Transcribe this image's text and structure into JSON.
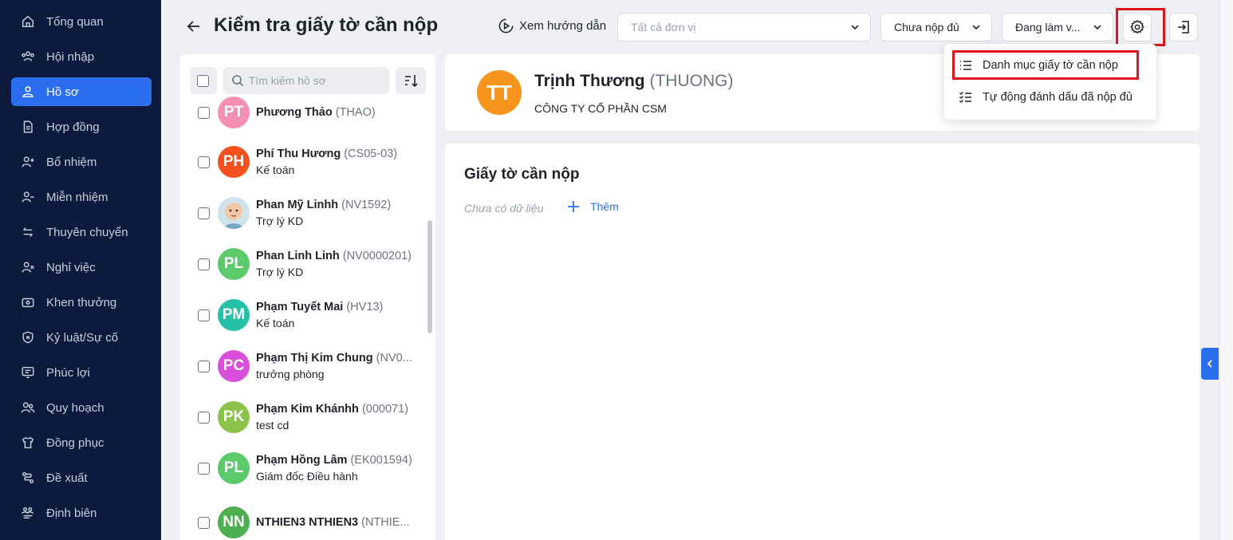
{
  "sidebar": {
    "items": [
      {
        "label": "Tổng quan",
        "icon": "home-icon"
      },
      {
        "label": "Hội nhập",
        "icon": "onboarding-icon"
      },
      {
        "label": "Hồ sơ",
        "icon": "user-icon",
        "active": true
      },
      {
        "label": "Hợp đồng",
        "icon": "document-icon"
      },
      {
        "label": "Bổ nhiệm",
        "icon": "user-add-icon"
      },
      {
        "label": "Miễn nhiệm",
        "icon": "user-remove-icon"
      },
      {
        "label": "Thuyên chuyển",
        "icon": "transfer-icon"
      },
      {
        "label": "Nghỉ việc",
        "icon": "user-leave-icon"
      },
      {
        "label": "Khen thưởng",
        "icon": "reward-icon"
      },
      {
        "label": "Kỷ luật/Sự cố",
        "icon": "shield-icon"
      },
      {
        "label": "Phúc lợi",
        "icon": "benefit-icon"
      },
      {
        "label": "Quy hoạch",
        "icon": "planning-icon"
      },
      {
        "label": "Đồng phục",
        "icon": "uniform-icon"
      },
      {
        "label": "Đề xuất",
        "icon": "proposal-icon"
      },
      {
        "label": "Định biên",
        "icon": "headcount-icon"
      }
    ]
  },
  "header": {
    "title": "Kiểm tra giấy tờ cần nộp",
    "guide_label": "Xem hướng dẫn",
    "unit_select": "Tất cả đơn vị",
    "status_select": "Chưa nộp đủ",
    "work_select": "Đang làm v..."
  },
  "list": {
    "search_placeholder": "Tìm kiếm hồ sơ",
    "employees": [
      {
        "initials": "PT",
        "name": "Phương Thảo",
        "code": "(THAO)",
        "role": "",
        "color": "#f48fb1"
      },
      {
        "initials": "PH",
        "name": "Phí Thu Hương",
        "code": "(CS05-03)",
        "role": "Kế toán",
        "color": "#f4511e"
      },
      {
        "initials": "",
        "name": "Phan Mỹ Linhh",
        "code": "(NV1592)",
        "role": "Trợ lý KD",
        "color": "#d7b49e",
        "photo": true
      },
      {
        "initials": "PL",
        "name": "Phan Linh Linh",
        "code": "(NV0000201)",
        "role": "Trợ lý KD",
        "color": "#5cc96b"
      },
      {
        "initials": "PM",
        "name": "Phạm Tuyết Mai",
        "code": "(HV13)",
        "role": "Kế toán",
        "color": "#26bfa8"
      },
      {
        "initials": "PC",
        "name": "Phạm Thị Kim Chung",
        "code": "(NV0...",
        "role": "trưởng phòng",
        "color": "#d94fd9"
      },
      {
        "initials": "PK",
        "name": "Phạm Kim Khánhh",
        "code": "(000071)",
        "role": "test cd",
        "color": "#8bc34a"
      },
      {
        "initials": "PL",
        "name": "Phạm Hồng Lâm",
        "code": "(EK001594)",
        "role": "Giám đốc Điều hành",
        "color": "#5cc96b"
      },
      {
        "initials": "NN",
        "name": "NTHIEN3 NTHIEN3",
        "code": "(NTHIE...",
        "role": "",
        "color": "#4caf50"
      }
    ]
  },
  "profile": {
    "initials": "TT",
    "name": "Trịnh Thương",
    "code": "(THUONG)",
    "company": "CÔNG TY CỔ PHẦN CSM",
    "avatar_color": "#f7941d"
  },
  "documents": {
    "title": "Giấy tờ cần nộp",
    "empty_text": "Chưa có dữ liệu",
    "add_label": "Thêm"
  },
  "menu": {
    "items": [
      {
        "label": "Danh mục giấy tờ cần nộp",
        "icon": "list-icon"
      },
      {
        "label": "Tự động đánh dấu đã nộp đủ",
        "icon": "checklist-icon"
      }
    ]
  },
  "colors": {
    "sidebar_bg": "#0c1b3d",
    "accent": "#2b6ff0",
    "highlight": "#e0121a"
  }
}
